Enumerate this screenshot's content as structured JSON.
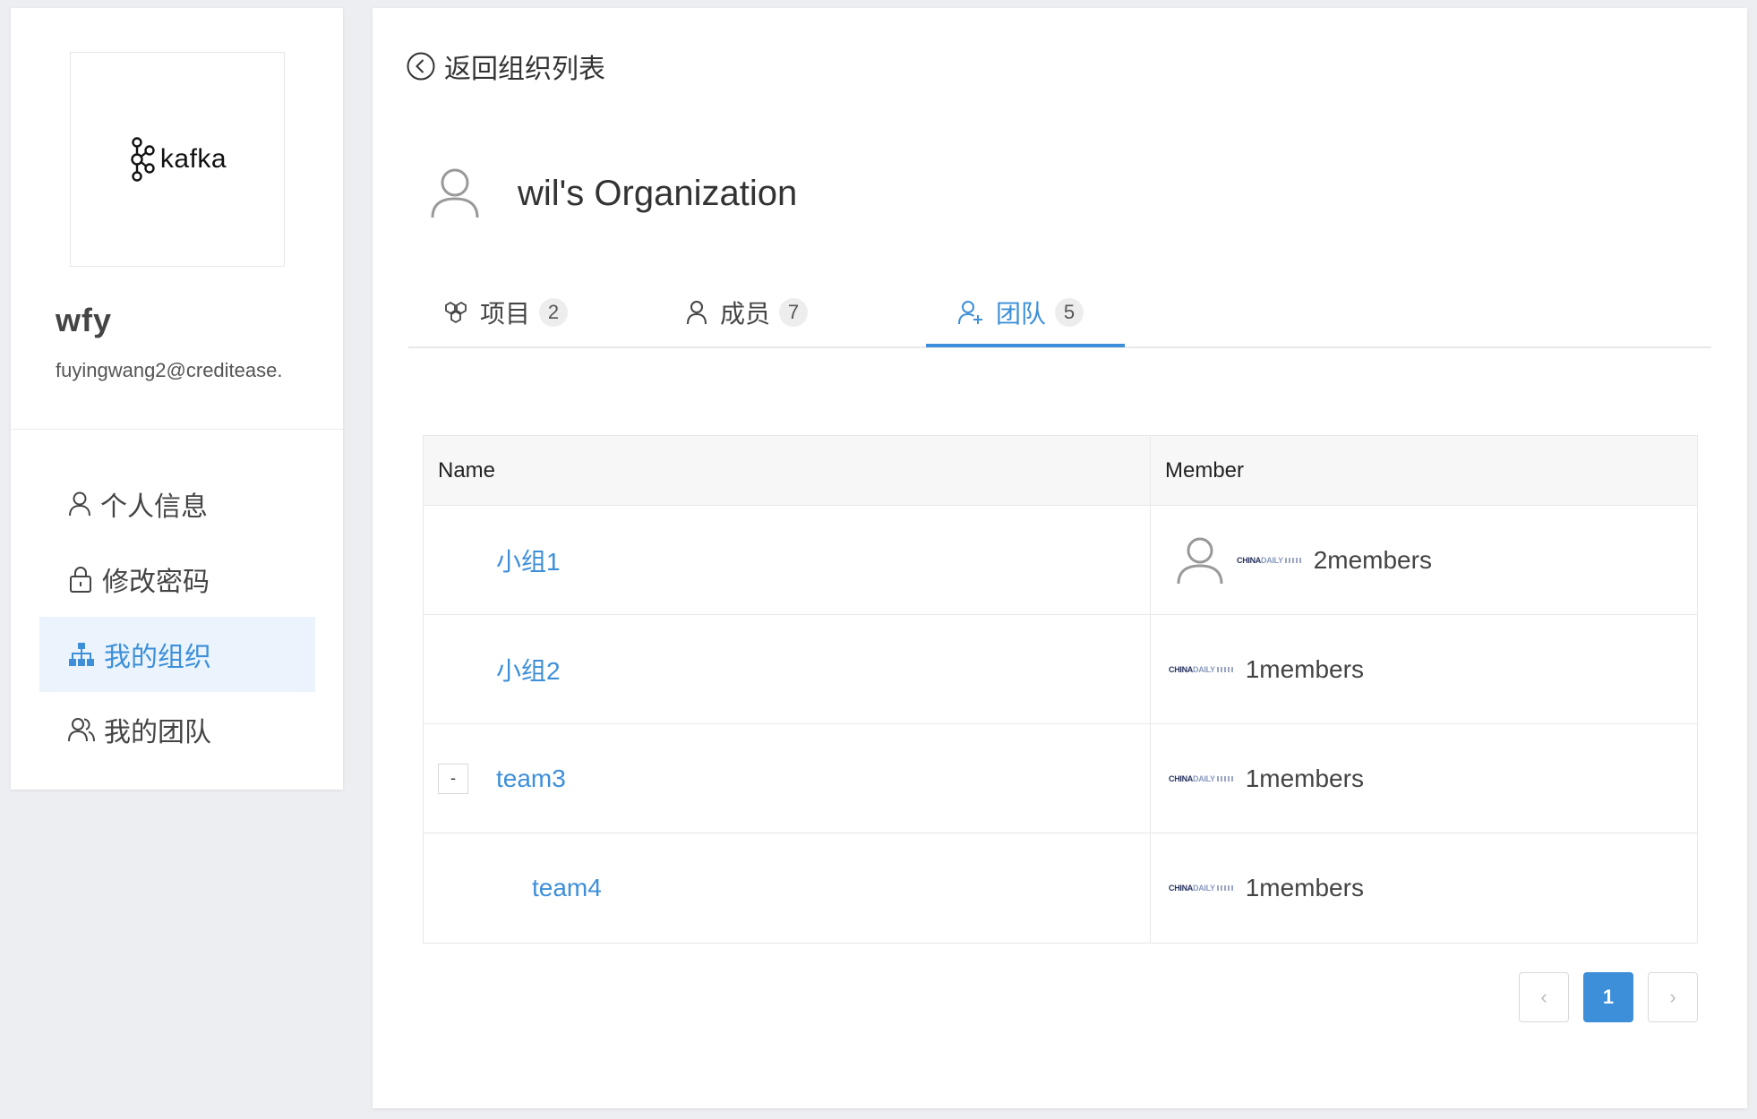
{
  "sidebar": {
    "logo_text": "kafka",
    "user_name": "wfy",
    "user_email": "fuyingwang2@creditease.",
    "menu": [
      {
        "label": "个人信息",
        "icon": "user-icon"
      },
      {
        "label": "修改密码",
        "icon": "lock-icon"
      },
      {
        "label": "我的组织",
        "icon": "org-tree-icon",
        "active": true
      },
      {
        "label": "我的团队",
        "icon": "team-icon"
      }
    ]
  },
  "main": {
    "back_label": "返回组织列表",
    "org_title": "wil's Organization",
    "tabs": [
      {
        "label": "项目",
        "count": "2",
        "icon": "projects-icon"
      },
      {
        "label": "成员",
        "count": "7",
        "icon": "member-icon"
      },
      {
        "label": "团队",
        "count": "5",
        "icon": "team-add-icon",
        "active": true
      }
    ],
    "table": {
      "headers": {
        "name": "Name",
        "member": "Member"
      },
      "rows": [
        {
          "name": "小组1",
          "members": "2members",
          "avatars": [
            "default-avatar",
            "chinadaily-logo"
          ]
        },
        {
          "name": "小组2",
          "members": "1members",
          "avatars": [
            "chinadaily-logo"
          ]
        },
        {
          "name": "team3",
          "members": "1members",
          "avatars": [
            "chinadaily-logo"
          ],
          "expand": "-"
        },
        {
          "name": "team4",
          "members": "1members",
          "avatars": [
            "chinadaily-logo"
          ]
        }
      ]
    },
    "logo_small": {
      "part1": "CHINA",
      "part2": "DAILY"
    },
    "pagination": {
      "prev": "‹",
      "current": "1",
      "next": "›"
    }
  },
  "colors": {
    "accent": "#3d8fd9",
    "active_bg": "#ebf4fd",
    "page_bg": "#eceef1"
  }
}
